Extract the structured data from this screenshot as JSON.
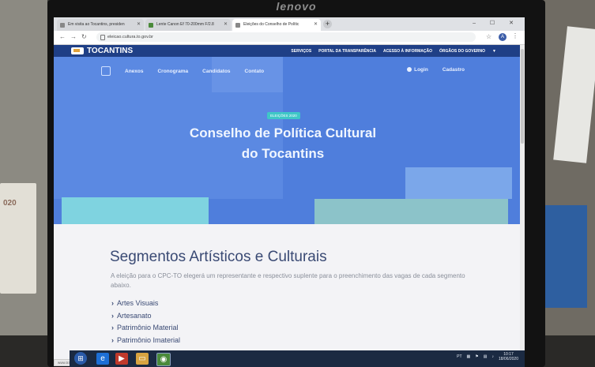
{
  "monitor": {
    "brand": "lenovo"
  },
  "calendar": {
    "label": "020"
  },
  "browser": {
    "tabs": [
      {
        "label": "Em visita ao Tocantins, presiden",
        "active": false
      },
      {
        "label": "Lente Canon Ef 70-200mm F/2.8",
        "active": false
      },
      {
        "label": "Eleições do Conselho de Polític",
        "active": true
      }
    ],
    "new_tab": "+",
    "url": "eleicao.cultura.to.gov.br",
    "win_controls": "– ☐ ✕",
    "account_initial": "A"
  },
  "site": {
    "logo": "TOCANTINS",
    "top_links": [
      "SERVIÇOS",
      "PORTAL DA TRANSPARÊNCIA",
      "ACESSO À INFORMAÇÃO",
      "ÓRGÃOS DO GOVERNO"
    ],
    "nav": [
      "Anexos",
      "Cronograma",
      "Candidatos",
      "Contato"
    ],
    "login": "Login",
    "signup": "Cadastro",
    "badge": "ELEIÇÕES 2020",
    "title_line1": "Conselho de Política Cultural",
    "title_line2": "do Tocantins",
    "section_title": "Segmentos Artísticos e Culturais",
    "section_desc": "A eleição para o CPC-TO elegerá um representante e respectivo suplente para o preenchimento das vagas de cada segmento abaixo.",
    "segments": [
      "Artes Visuais",
      "Artesanato",
      "Patrimônio Material",
      "Patrimônio Imaterial"
    ],
    "status_url": "www.transparencia.to.gov.br"
  },
  "taskbar": {
    "lang": "PT",
    "time": "10:17",
    "date": "18/06/2020"
  },
  "colors": {
    "hero": "#4f7edc",
    "top_strip": "#1f3f86",
    "accent_teal": "#3fc7c7",
    "heading_text": "#3a4a74"
  }
}
